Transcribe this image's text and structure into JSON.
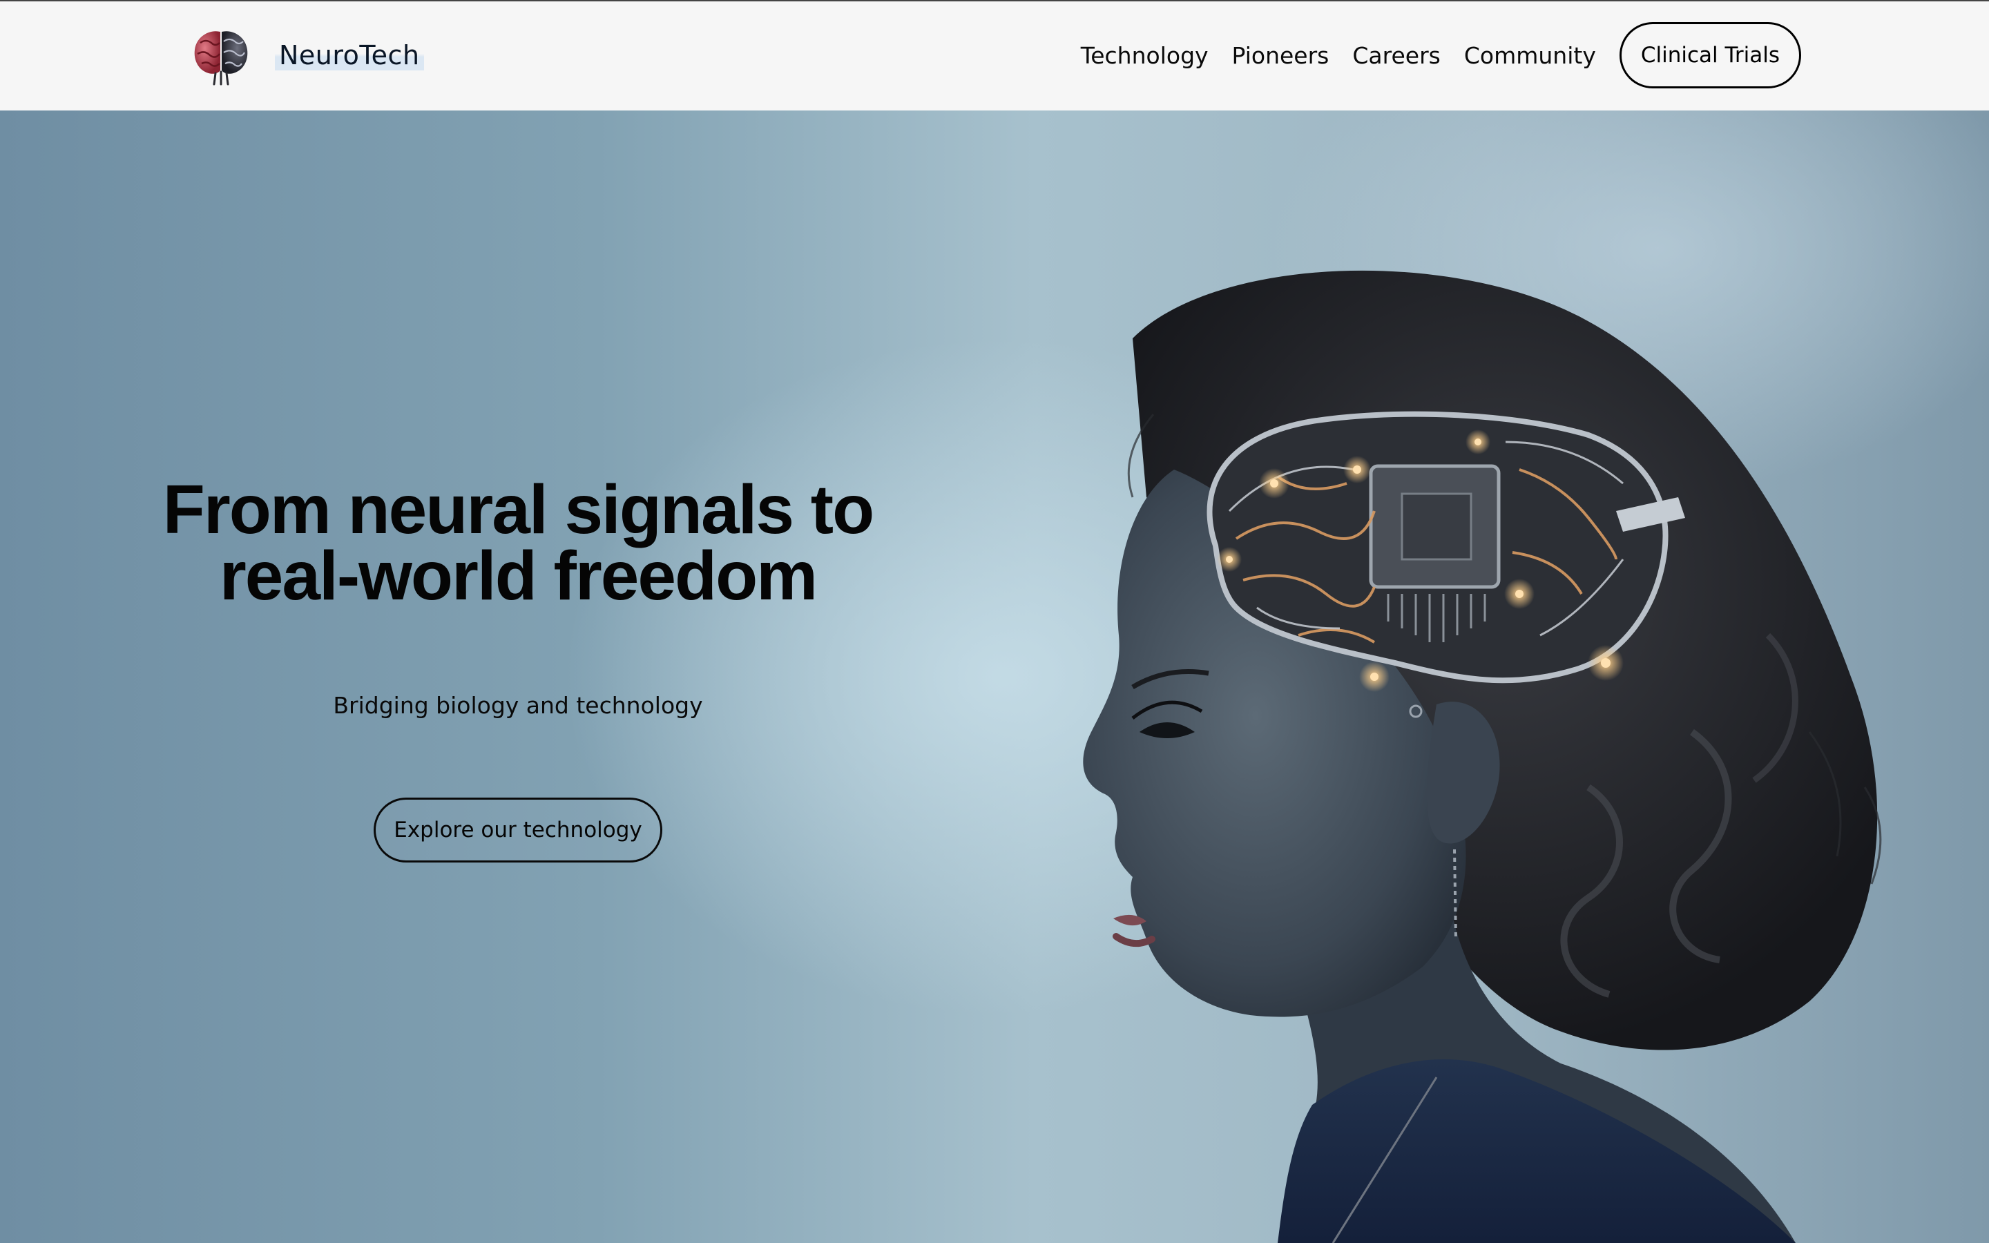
{
  "header": {
    "brand_name": "NeuroTech",
    "logo_icon": "brain-logo-icon",
    "nav": [
      {
        "label": "Technology"
      },
      {
        "label": "Pioneers"
      },
      {
        "label": "Careers"
      },
      {
        "label": "Community"
      }
    ],
    "cta_label": "Clinical Trials"
  },
  "hero": {
    "headline_line1": "From neural signals to",
    "headline_line2": "real-world freedom",
    "subheadline": "Bridging biology and technology",
    "cta_label": "Explore our technology",
    "image": "girl-with-circuit-brain-illustration"
  },
  "colors": {
    "header_bg": "#f6f6f6",
    "hero_bg": "#8fabbb",
    "text": "#000000",
    "accent_glow": "#ffb36b"
  }
}
